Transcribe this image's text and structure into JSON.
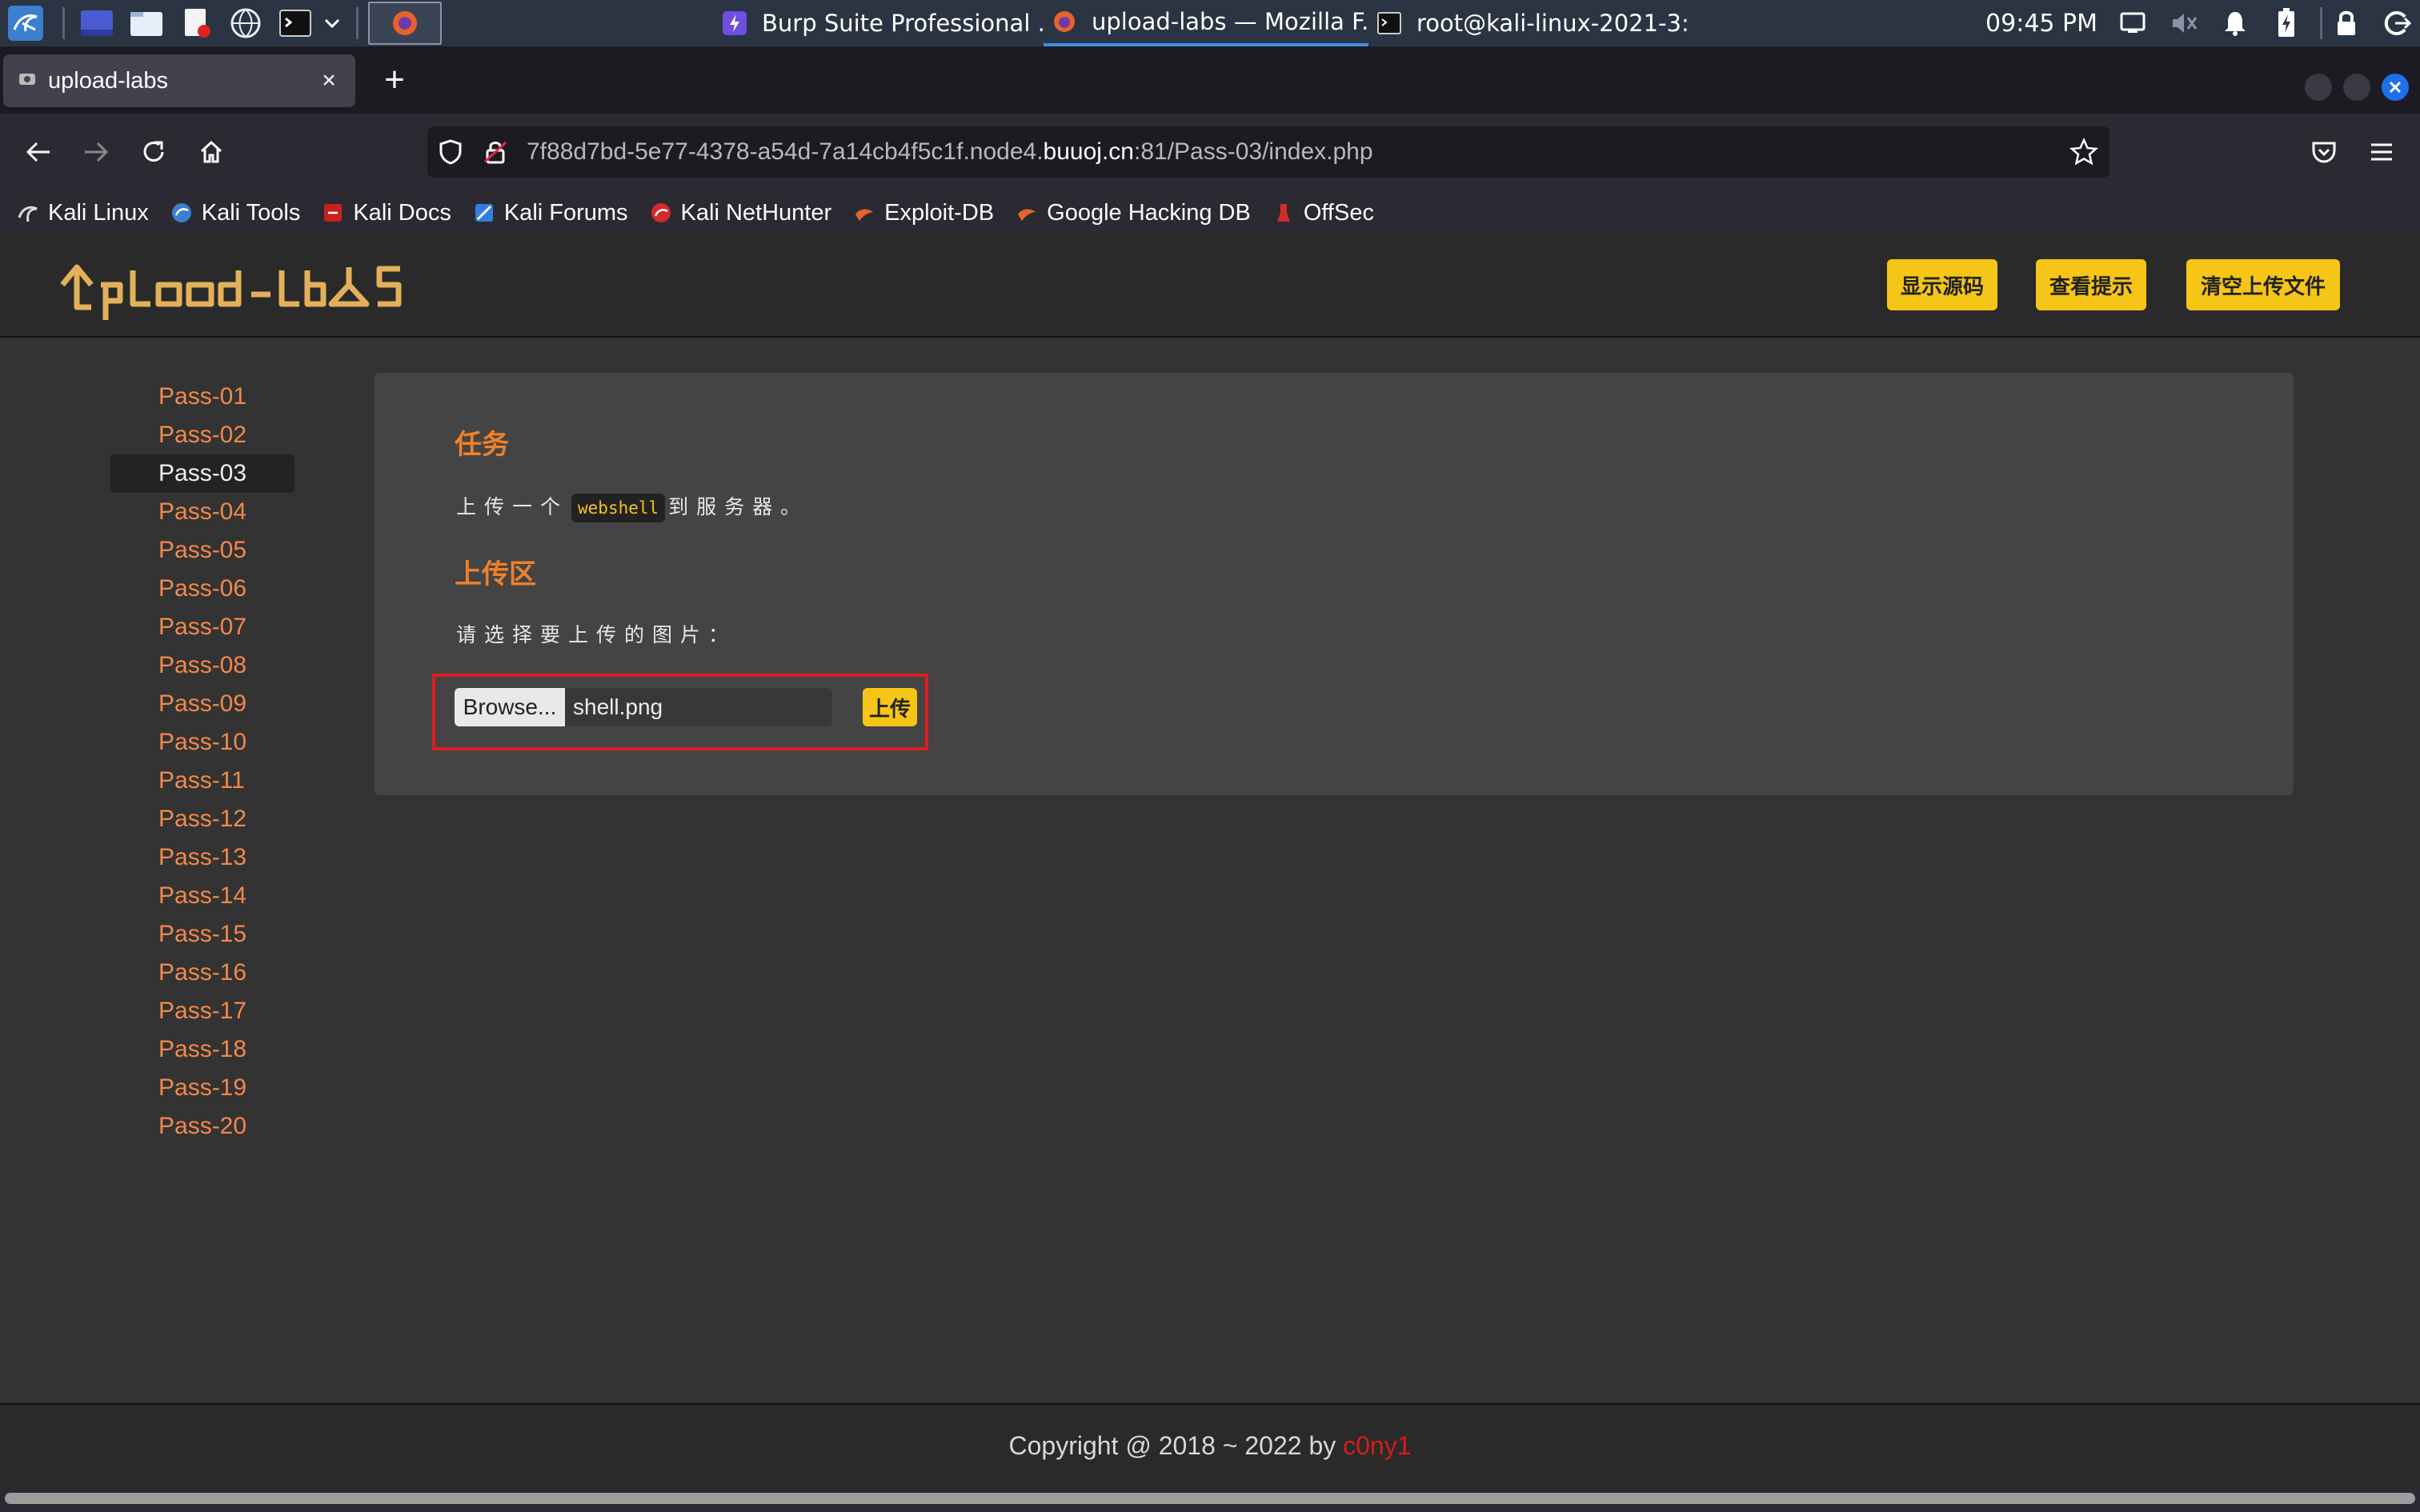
{
  "taskbar": {
    "windows": [
      {
        "title": "Burp Suite Professional ...",
        "icon": "burp-icon"
      },
      {
        "title": "upload-labs — Mozilla F...",
        "icon": "firefox-icon"
      },
      {
        "title": "root@kali-linux-2021-3: ~",
        "icon": "terminal-icon"
      }
    ],
    "clock": "09:45 PM"
  },
  "browser": {
    "tab_title": "upload-labs",
    "tab_close": "×",
    "new_tab": "+",
    "url_prefix": "7f88d7bd-5e77-4378-a54d-7a14cb4f5c1f.node4.",
    "url_host": "buuoj.cn",
    "url_suffix": ":81/Pass-03/index.php",
    "bookmarks": [
      "Kali Linux",
      "Kali Tools",
      "Kali Docs",
      "Kali Forums",
      "Kali NetHunter",
      "Exploit-DB",
      "Google Hacking DB",
      "OffSec"
    ]
  },
  "site": {
    "logo_text": "upload-labs",
    "header_buttons": [
      "显示源码",
      "查看提示",
      "清空上传文件"
    ],
    "passes": [
      "Pass-01",
      "Pass-02",
      "Pass-03",
      "Pass-04",
      "Pass-05",
      "Pass-06",
      "Pass-07",
      "Pass-08",
      "Pass-09",
      "Pass-10",
      "Pass-11",
      "Pass-12",
      "Pass-13",
      "Pass-14",
      "Pass-15",
      "Pass-16",
      "Pass-17",
      "Pass-18",
      "Pass-19",
      "Pass-20"
    ],
    "active_pass": "Pass-03",
    "task_heading": "任务",
    "task_before": "上传一个",
    "task_code": "webshell",
    "task_after": "到服务器。",
    "upload_heading": "上传区",
    "upload_prompt": "请选择要上传的图片：",
    "browse_label": "Browse...",
    "file_name": "shell.png",
    "upload_button": "上传",
    "copyright": "Copyright @ 2018 ~ 2022 by ",
    "author": "c0ny1"
  },
  "colors": {
    "accent_yellow": "#f5c518",
    "link_orange": "#f2884b",
    "heading_orange": "#f0802a",
    "highlight_red": "#e01b24"
  }
}
